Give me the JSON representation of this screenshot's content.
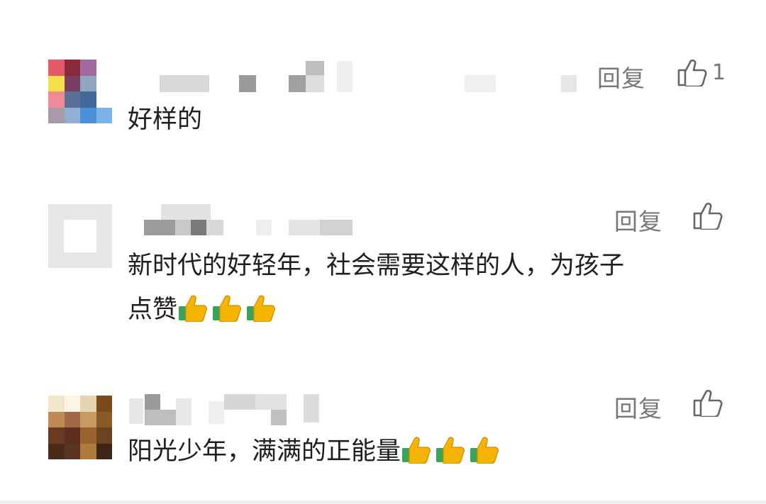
{
  "comments": [
    {
      "reply_label": "回复",
      "like_count": "1",
      "text": "好样的",
      "emoji_count": 0
    },
    {
      "reply_label": "回复",
      "like_count": "",
      "text_line1": "新时代的好轻年，社会需要这样的人，为孩子",
      "text_line2": "点赞",
      "emoji_count": 3
    },
    {
      "reply_label": "回复",
      "like_count": "",
      "text": "阳光少年，满满的正能量",
      "emoji_count": 3
    }
  ],
  "icons": {
    "like": "thumbs-up-outline-icon",
    "emoji": "thumbs-up-emoji-icon"
  },
  "colors": {
    "reply_text": "#777777",
    "comment_text": "#1f1f1f",
    "emoji_yellow": "#f4b400",
    "emoji_green": "#3aa35a"
  }
}
